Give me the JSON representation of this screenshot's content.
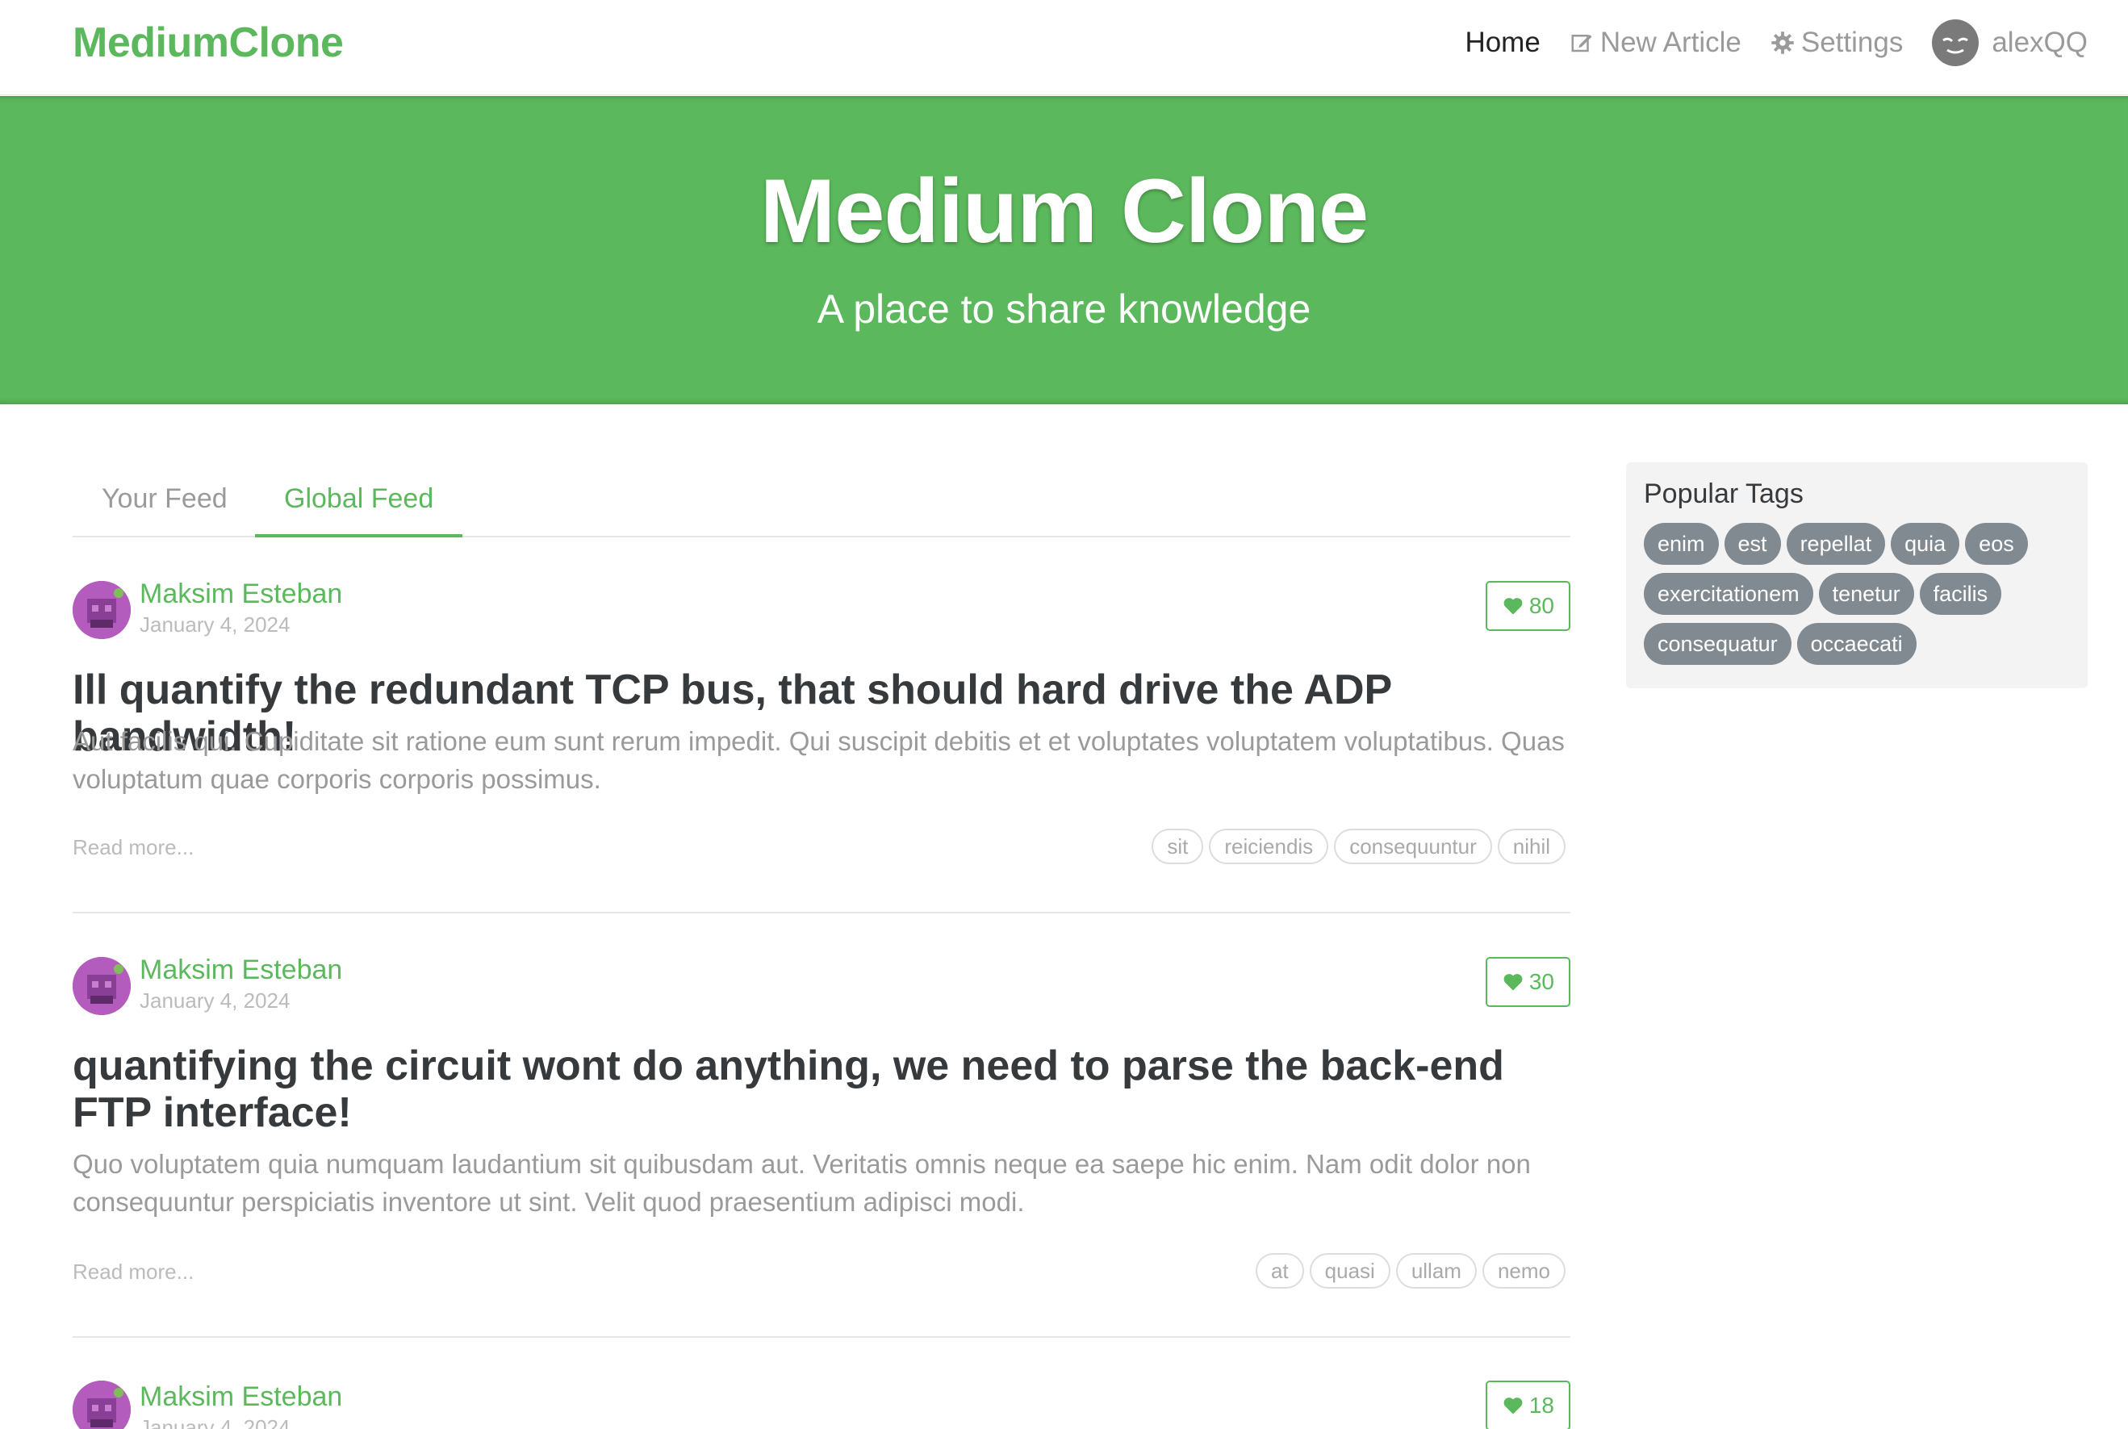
{
  "nav": {
    "brand": "MediumClone",
    "home": "Home",
    "new_article": "New Article",
    "settings": "Settings",
    "username": "alexQQ"
  },
  "banner": {
    "title": "Medium Clone",
    "subtitle": "A place to share knowledge"
  },
  "tabs": {
    "your_feed": "Your Feed",
    "global_feed": "Global Feed"
  },
  "articles": [
    {
      "author": "Maksim Esteban",
      "date": "January 4, 2024",
      "likes": "80",
      "title": "Ill quantify the redundant TCP bus, that should hard drive the ADP bandwidth!",
      "description": "Aut facilis qui. Cupiditate sit ratione eum sunt rerum impedit. Qui suscipit debitis et et voluptates voluptatem voluptatibus. Quas voluptatum quae corporis corporis possimus.",
      "read_more": "Read more...",
      "tags": [
        "sit",
        "reiciendis",
        "consequuntur",
        "nihil"
      ]
    },
    {
      "author": "Maksim Esteban",
      "date": "January 4, 2024",
      "likes": "30",
      "title": "quantifying the circuit wont do anything, we need to parse the back-end FTP interface!",
      "description": "Quo voluptatem quia numquam laudantium sit quibusdam aut. Veritatis omnis neque ea saepe hic enim. Nam odit dolor non consequuntur perspiciatis inventore ut sint. Velit quod praesentium adipisci modi.",
      "read_more": "Read more...",
      "tags": [
        "at",
        "quasi",
        "ullam",
        "nemo"
      ]
    },
    {
      "author": "Maksim Esteban",
      "date": "January 4, 2024",
      "likes": "18"
    }
  ],
  "sidebar": {
    "title": "Popular Tags",
    "tags": [
      "enim",
      "est",
      "repellat",
      "quia",
      "eos",
      "exercitationem",
      "tenetur",
      "facilis",
      "consequatur",
      "occaecati"
    ]
  },
  "colors": {
    "brand": "#5cb85c",
    "tag_pill": "#818a91",
    "muted": "#bbbbbb"
  },
  "icons": {
    "new_article": "edit-icon",
    "settings": "gear-icon",
    "like": "heart-icon"
  }
}
